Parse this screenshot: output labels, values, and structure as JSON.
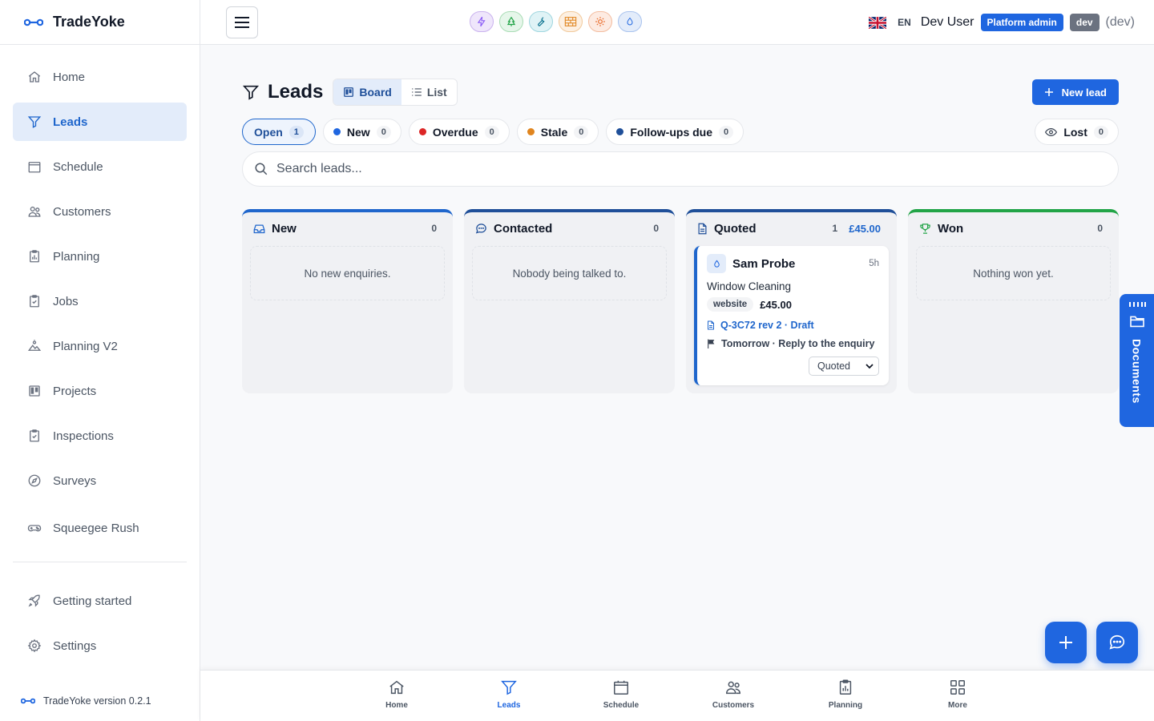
{
  "brand": {
    "name": "TradeYoke",
    "version": "TradeYoke version 0.2.1"
  },
  "sidebar": {
    "items": [
      {
        "label": "Home",
        "icon": "home-icon"
      },
      {
        "label": "Leads",
        "icon": "funnel-icon",
        "active": true
      },
      {
        "label": "Schedule",
        "icon": "calendar-icon"
      },
      {
        "label": "Customers",
        "icon": "users-icon"
      },
      {
        "label": "Planning",
        "icon": "clipboard-chart-icon"
      },
      {
        "label": "Jobs",
        "icon": "clipboard-check-icon"
      },
      {
        "label": "Planning V2",
        "icon": "landscape-icon"
      },
      {
        "label": "Projects",
        "icon": "kanban-icon"
      },
      {
        "label": "Inspections",
        "icon": "clipboard-check-icon"
      },
      {
        "label": "Surveys",
        "icon": "compass-icon"
      },
      {
        "label": "Squeegee Rush",
        "icon": "gamepad-icon"
      }
    ],
    "footer_items": [
      {
        "label": "Getting started",
        "icon": "rocket-icon"
      },
      {
        "label": "Settings",
        "icon": "gear-icon"
      }
    ]
  },
  "topbar": {
    "trade_icons": [
      "lightning-icon",
      "tree-icon",
      "wrench-icon",
      "brick-icon",
      "sun-icon",
      "water-drop-icon"
    ],
    "lang": "EN",
    "user_name": "Dev User",
    "role_badge": "Platform admin",
    "env_badge": "dev",
    "env_text": "(dev)"
  },
  "page": {
    "title": "Leads",
    "views": {
      "board": "Board",
      "list": "List",
      "active": "board"
    },
    "new_lead": "New lead",
    "filters": [
      {
        "label": "Open",
        "count": "1",
        "active": true
      },
      {
        "label": "New",
        "count": "0",
        "color": "#1f66e0"
      },
      {
        "label": "Overdue",
        "count": "0",
        "color": "#dc2626"
      },
      {
        "label": "Stale",
        "count": "0",
        "color": "#e0851f"
      },
      {
        "label": "Follow-ups due",
        "count": "0",
        "color": "#1f4f99"
      }
    ],
    "lost": {
      "label": "Lost",
      "count": "0"
    },
    "search_placeholder": "Search leads..."
  },
  "board": {
    "columns": [
      {
        "title": "New",
        "count": "0",
        "color": "#1f66cc",
        "empty": "No new enquiries.",
        "icon": "inbox-icon"
      },
      {
        "title": "Contacted",
        "count": "0",
        "color": "#1f4f99",
        "empty": "Nobody being talked to.",
        "icon": "chat-bubble-icon"
      },
      {
        "title": "Quoted",
        "count": "1",
        "total": "£45.00",
        "color": "#1f4f99",
        "icon": "document-icon",
        "cards": [
          {
            "name": "Sam Probe",
            "age": "5h",
            "service": "Window Cleaning",
            "source": "website",
            "price": "£45.00",
            "quote": "Q-3C72 rev 2 · Draft",
            "followup": "Tomorrow · Reply to the enquiry",
            "stage": "Quoted"
          }
        ]
      },
      {
        "title": "Won",
        "count": "0",
        "color": "#22a447",
        "empty": "Nothing won yet.",
        "icon": "trophy-icon"
      }
    ]
  },
  "documents_tab": "Documents",
  "bottom_nav": [
    {
      "label": "Home",
      "icon": "home-icon"
    },
    {
      "label": "Leads",
      "icon": "funnel-icon",
      "active": true
    },
    {
      "label": "Schedule",
      "icon": "calendar-icon"
    },
    {
      "label": "Customers",
      "icon": "users-icon"
    },
    {
      "label": "Planning",
      "icon": "clipboard-chart-icon"
    },
    {
      "label": "More",
      "icon": "grid-icon"
    }
  ],
  "colors": {
    "accent": "#1f66e0",
    "active_bg": "#e3ecfa",
    "won": "#22a447"
  }
}
